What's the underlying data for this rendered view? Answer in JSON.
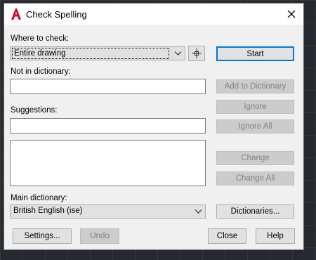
{
  "window": {
    "title": "Check Spelling",
    "app_icon": "autocad-a-icon",
    "close_icon": "close-icon"
  },
  "where_to_check": {
    "label": "Where to check:",
    "value": "Entire drawing",
    "pick_icon": "crosshair-select-icon"
  },
  "not_in_dictionary": {
    "label": "Not in dictionary:",
    "value": ""
  },
  "suggestions": {
    "label": "Suggestions:",
    "value": "",
    "list_items": []
  },
  "main_dictionary": {
    "label": "Main dictionary:",
    "value": "British English (ise)"
  },
  "buttons": {
    "start": "Start",
    "add_to_dictionary": "Add to Dictionary",
    "ignore": "Ignore",
    "ignore_all": "Ignore All",
    "change": "Change",
    "change_all": "Change All",
    "dictionaries": "Dictionaries...",
    "settings": "Settings...",
    "undo": "Undo",
    "close": "Close",
    "help": "Help"
  },
  "colors": {
    "default_button_border": "#0078d7",
    "app_icon_red": "#c8102e"
  }
}
